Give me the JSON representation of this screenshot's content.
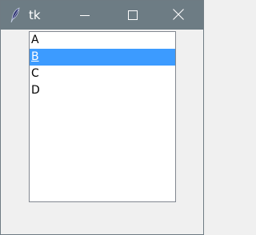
{
  "window": {
    "title": "tk",
    "titlebar_color": "#6d7c84",
    "app_icon": "tk-feather-icon"
  },
  "controls": {
    "minimize_icon": "minimize-icon",
    "maximize_icon": "maximize-icon",
    "close_icon": "close-icon"
  },
  "listbox": {
    "items": [
      "A",
      "B",
      "C",
      "D"
    ],
    "selected_index": 1,
    "selection_color": "#3c9bff"
  }
}
